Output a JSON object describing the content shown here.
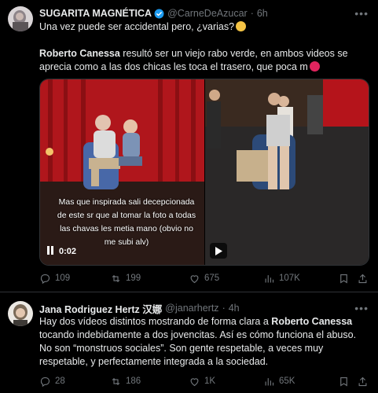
{
  "tweet1": {
    "author_name": "SUGARITA MAGNÉTICA",
    "handle": "@CarneDeAzucar",
    "separator": "·",
    "time": "6h",
    "line1": "Una vez puede ser accidental pero, ¿varias?",
    "bold_name": "Roberto Canessa",
    "line2_rest": " resultó ser un viejo rabo verde, en ambos videos se",
    "line3": "aprecia como a las dos chicas les toca el trasero, que poca m",
    "video": {
      "caption": "Mas que inspirada sali decepcionada de este sr que al tomar la foto a todas las chavas les metia mano (obvio no me subi alv)",
      "time": "0:02"
    },
    "actions": {
      "replies": "109",
      "reposts": "199",
      "likes": "675",
      "views": "107K"
    }
  },
  "tweet2": {
    "author_name": "Jana Rodriguez Hertz 汉娜",
    "handle": "@janarhertz",
    "separator": "·",
    "time": "4h",
    "line1_pre": "Hay dos vídeos distintos mostrando de forma clara a ",
    "bold_name": "Roberto Canessa",
    "line2": "tocando indebidamente a dos jovencitas. Así es cómo funciona el abuso.",
    "line3": "No son “monstruos sociales”. Son gente respetable, a veces muy",
    "line4": "respetable, y perfectamente integrada a la sociedad.",
    "actions": {
      "replies": "28",
      "reposts": "186",
      "likes": "1K",
      "views": "65K"
    }
  },
  "colors": {
    "background": "#000000",
    "text": "#e7e9ea",
    "muted": "#71767b",
    "verified": "#1d9bf0",
    "divider": "#2f3336"
  }
}
